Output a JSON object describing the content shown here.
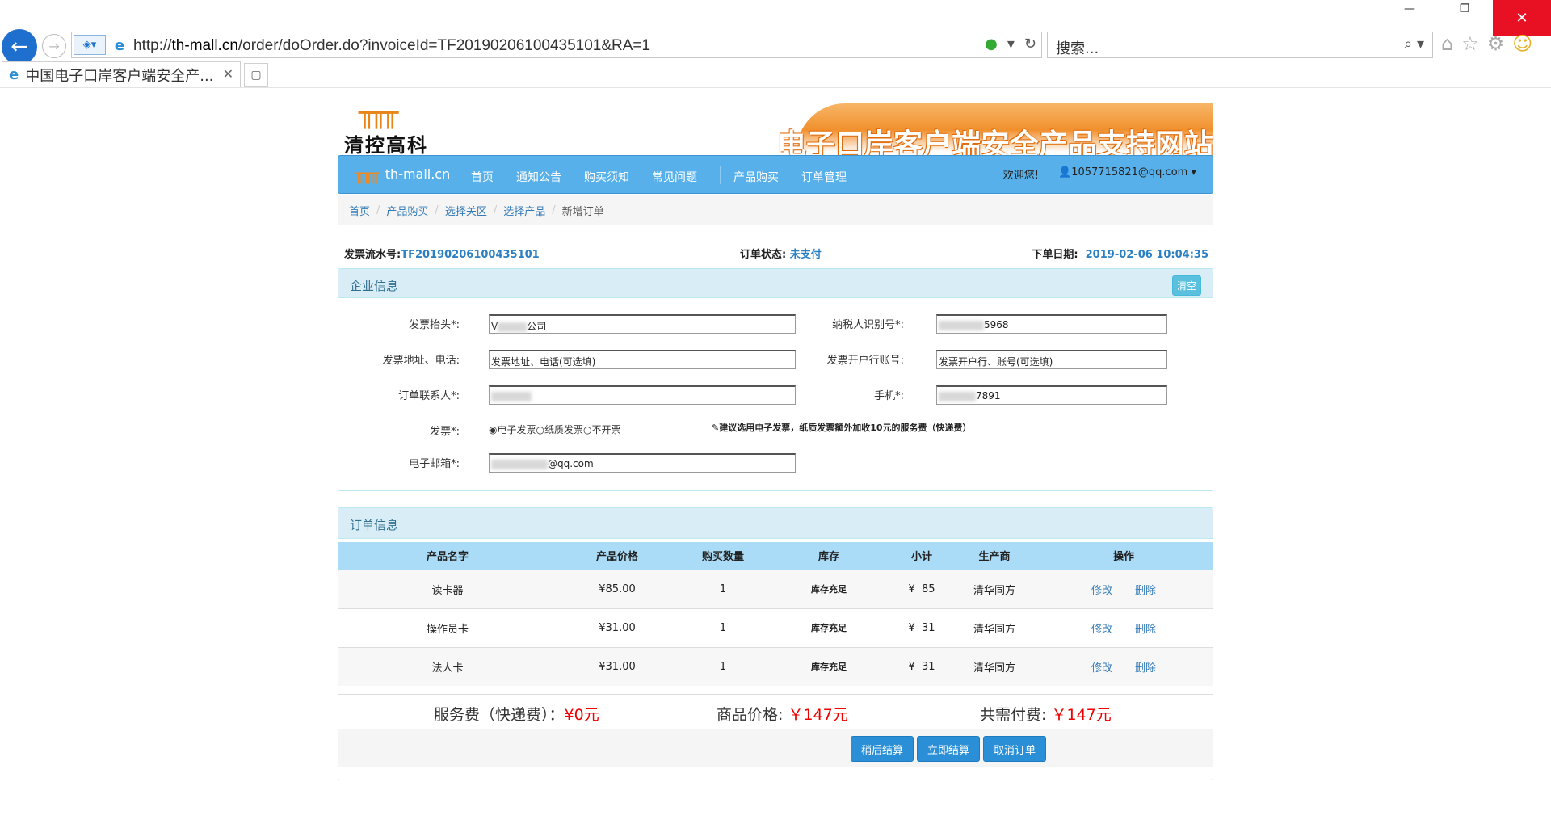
{
  "browser": {
    "url_prefix": "http://",
    "url_host": "th-mall.cn",
    "url_path": "/order/doOrder.do?invoiceId=TF20190206100435101&RA=1",
    "search_placeholder": "搜索...",
    "tab_title": "中国电子口岸客户端安全产...",
    "minimize_label": "—",
    "restore_label": "❐",
    "close_label": "✕"
  },
  "header": {
    "logo_mark": "╥╥╥",
    "logo_name": "清控高科",
    "banner_text": "电子口岸客户端安全产品支持网站"
  },
  "nav": {
    "brand": "th-mall.cn",
    "items": [
      "首页",
      "通知公告",
      "购买须知",
      "常见问题",
      "产品购买",
      "订单管理"
    ],
    "welcome": "欢迎您!",
    "user": "1057715821@qq.com"
  },
  "breadcrumb": [
    "首页",
    "产品购买",
    "选择关区",
    "选择产品",
    "新增订单"
  ],
  "meta": {
    "serial_label": "发票流水号:",
    "serial_value": "TF20190206100435101",
    "status_label": "订单状态:",
    "status_value": "未支付",
    "date_label": "下单日期:",
    "date_value": "2019-02-06 10:04:35"
  },
  "company": {
    "title": "企业信息",
    "clear_label": "清空",
    "invoice_title_label": "发票抬头*:",
    "invoice_title_prefix": "V",
    "invoice_title_suffix": "公司",
    "taxpayer_label": "纳税人识别号*:",
    "taxpayer_suffix": "5968",
    "address_label": "发票地址、电话:",
    "address_placeholder": "发票地址、电话(可选填)",
    "bank_label": "发票开户行账号:",
    "bank_placeholder": "发票开户行、账号(可选填)",
    "contact_label": "订单联系人*:",
    "mobile_label": "手机*:",
    "mobile_suffix": "7891",
    "invoice_type_label": "发票*:",
    "invoice_options": [
      "电子发票",
      "纸质发票",
      "不开票"
    ],
    "invoice_note": "建议选用电子发票，纸质发票额外加收10元的服务费（快递费）",
    "email_label": "电子邮箱*:",
    "email_suffix": "@qq.com"
  },
  "orders": {
    "title": "订单信息",
    "columns": [
      "产品名字",
      "产品价格",
      "购买数量",
      "库存",
      "小计",
      "生产商",
      "操作"
    ],
    "rows": [
      {
        "name": "读卡器",
        "price": "¥85.00",
        "qty": "1",
        "stock": "库存充足",
        "subtotal_sign": "¥",
        "subtotal": "85",
        "maker": "清华同方",
        "edit": "修改",
        "delete": "删除"
      },
      {
        "name": "操作员卡",
        "price": "¥31.00",
        "qty": "1",
        "stock": "库存充足",
        "subtotal_sign": "¥",
        "subtotal": "31",
        "maker": "清华同方",
        "edit": "修改",
        "delete": "删除"
      },
      {
        "name": "法人卡",
        "price": "¥31.00",
        "qty": "1",
        "stock": "库存充足",
        "subtotal_sign": "¥",
        "subtotal": "31",
        "maker": "清华同方",
        "edit": "修改",
        "delete": "删除"
      }
    ],
    "service_fee_label": "服务费（快递费）：",
    "service_fee_value": "¥0元",
    "goods_price_label": "商品价格:",
    "goods_price_value": "￥147元",
    "total_label": "共需付费:",
    "total_value": "￥147元",
    "btn_later": "稍后结算",
    "btn_now": "立即结算",
    "btn_cancel": "取消订单"
  }
}
